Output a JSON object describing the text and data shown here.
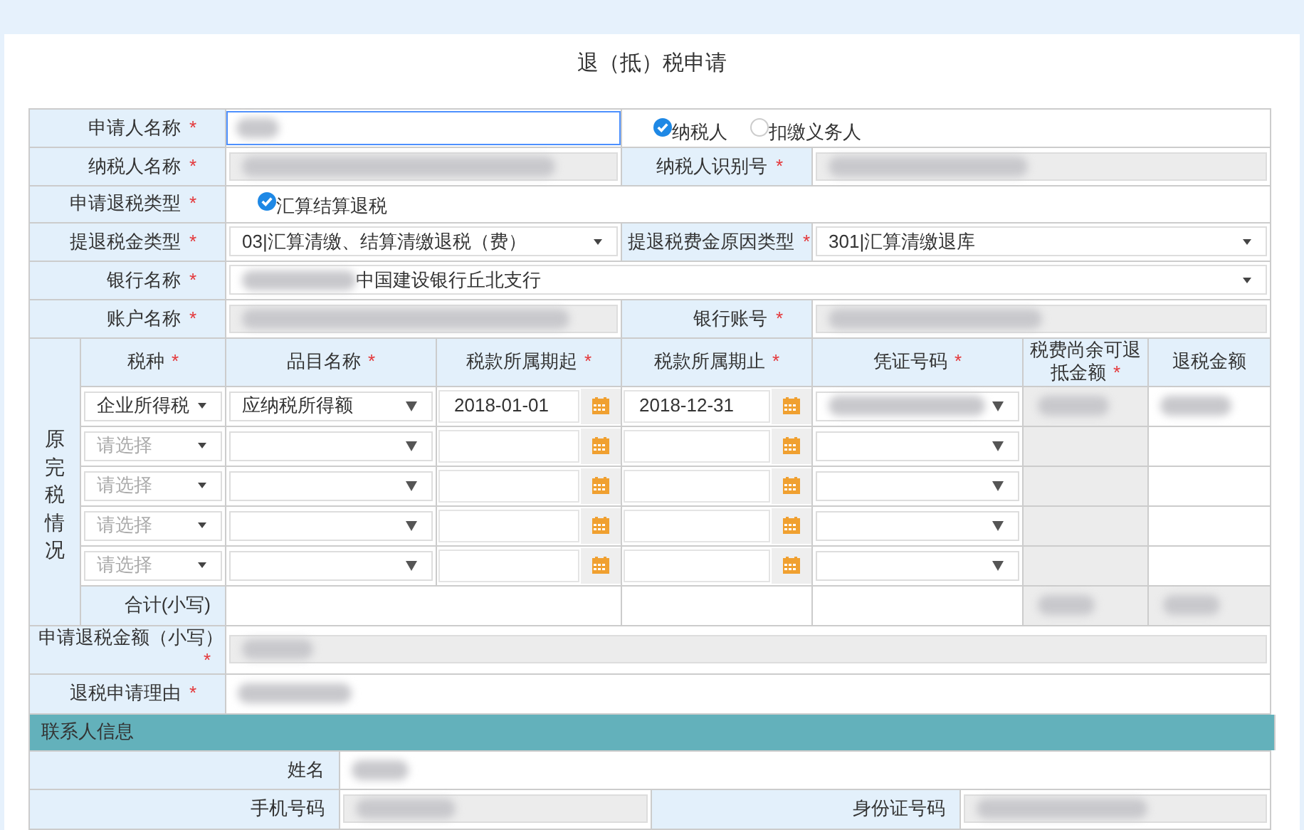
{
  "title": "退（抵）税申请",
  "applicant": {
    "label": "申请人名称",
    "mark": "*",
    "value_hidden": true
  },
  "role_options": [
    {
      "label": "纳税人",
      "selected": true
    },
    {
      "label": "扣缴义务人",
      "selected": false
    }
  ],
  "taxpayer_name": {
    "label": "纳税人名称",
    "mark": "*",
    "value_hidden": true
  },
  "taxpayer_id": {
    "label": "纳税人识别号",
    "mark": "*",
    "value_hidden": true
  },
  "refund_type": {
    "label": "申请退税类型",
    "mark": "*",
    "options": [
      {
        "label": "汇算结算退税",
        "checked": true
      }
    ]
  },
  "fund_type": {
    "label": "提退税金类型",
    "mark": "*",
    "value": "03|汇算清缴、结算清缴退税（费）"
  },
  "reason_type": {
    "label": "提退税费金原因类型",
    "mark": "*",
    "value": "301|汇算清缴退库"
  },
  "bank_name": {
    "label": "银行名称",
    "mark": "*",
    "value": "中国建设银行丘北支行",
    "value_hidden": true
  },
  "account_name": {
    "label": "账户名称",
    "mark": "*",
    "value_hidden": true
  },
  "account_no": {
    "label": "银行账号",
    "mark": "*",
    "value_hidden": true
  },
  "tax_table": {
    "side_label": "原完税情况",
    "columns": [
      {
        "label": "税种",
        "mark": "*"
      },
      {
        "label": "品目名称",
        "mark": "*"
      },
      {
        "label": "税款所属期起",
        "mark": "*"
      },
      {
        "label": "税款所属期止",
        "mark": "*"
      },
      {
        "label": "凭证号码",
        "mark": "*"
      },
      {
        "label": "税费尚余可退抵金额",
        "mark": "*"
      },
      {
        "label": "退税金额"
      }
    ],
    "rows": [
      {
        "tax_type": "企业所得税",
        "item": "应纳税所得额",
        "start": "2018-01-01",
        "end": "2018-12-31",
        "values_hidden": true
      },
      {
        "tax_type_placeholder": "请选择"
      },
      {
        "tax_type_placeholder": "请选择"
      },
      {
        "tax_type_placeholder": "请选择"
      },
      {
        "tax_type_placeholder": "请选择"
      }
    ],
    "total_label": "合计(小写)",
    "total_hidden": true
  },
  "refund_amount": {
    "label": "申请退税金额（小写）",
    "mark": "*",
    "value_hidden": true
  },
  "refund_reason": {
    "label": "退税申请理由",
    "mark": "*",
    "value_hidden": true
  },
  "contact": {
    "title": "联系人信息",
    "name_label": "姓名",
    "name_hidden": true,
    "phone_label": "手机号码",
    "phone_hidden": true,
    "id_label": "身份证号码",
    "id_hidden": true
  }
}
